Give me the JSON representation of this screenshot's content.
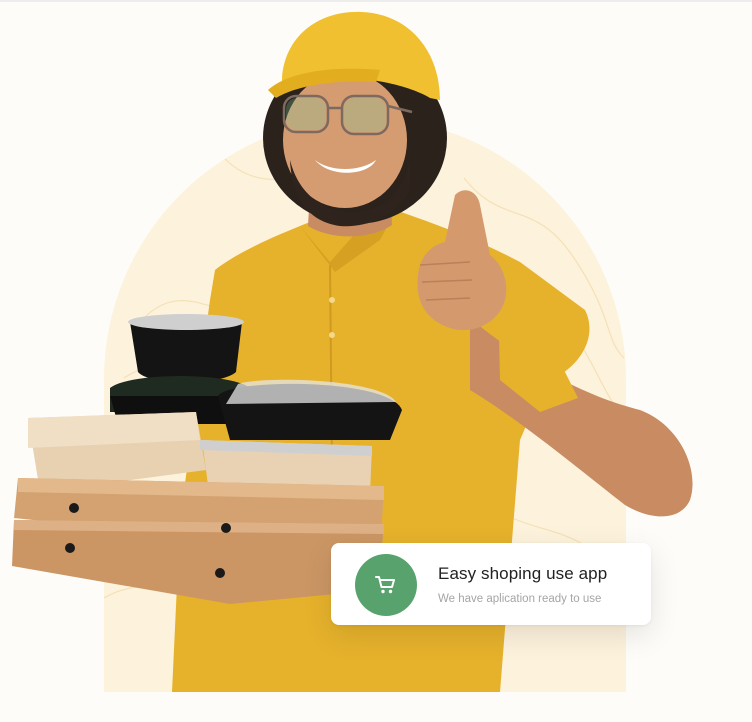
{
  "promo_card": {
    "title": "Easy shoping use app",
    "subtitle": "We have aplication ready to use",
    "icon": "shopping-cart-icon"
  },
  "colors": {
    "page_background": "#fdfcf8",
    "arch_background": "#fdf2dc",
    "shirt_yellow": "#e6b22c",
    "cap_yellow": "#f0c030",
    "icon_green": "#58a26e",
    "card_title": "#222222",
    "card_subtitle": "#a5a5a5"
  }
}
